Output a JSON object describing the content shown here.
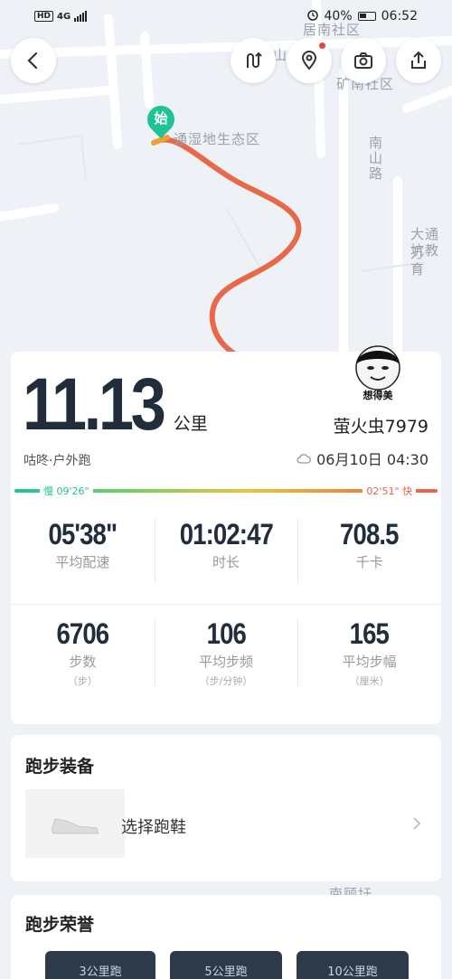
{
  "status_bar": {
    "network": "HD",
    "signal_gen": "4G",
    "battery": "40%",
    "time": "06:52"
  },
  "map_labels": {
    "l1": "居南社区",
    "l2": "矿南社区",
    "l3": "通湿地生态区",
    "l4": "南山路",
    "l5": "大通万",
    "l6": "坑教育",
    "l7": "山",
    "l8": "南顾圩"
  },
  "start_marker": "始",
  "summary": {
    "distance": "11.13",
    "distance_unit": "公里",
    "username": "萤火虫7979",
    "avatar_caption": "想得美",
    "subtitle": "咕咚·户外跑",
    "datetime": "06月10日 04:30",
    "pace_slow": "慢 09'26\"",
    "pace_fast": "02'51\" 快"
  },
  "stats_row1": [
    {
      "value": "05'38\"",
      "label": "平均配速"
    },
    {
      "value": "01:02:47",
      "label": "时长"
    },
    {
      "value": "708.5",
      "label": "千卡"
    }
  ],
  "stats_row2": [
    {
      "value": "6706",
      "label": "步数",
      "unit": "（步）"
    },
    {
      "value": "106",
      "label": "平均步频",
      "unit": "（步/分钟）"
    },
    {
      "value": "165",
      "label": "平均步幅",
      "unit": "（厘米）"
    }
  ],
  "gear": {
    "title": "跑步装备",
    "shoe_label": "选择跑鞋"
  },
  "honor": {
    "title": "跑步荣誉",
    "badges": [
      "3公里跑",
      "5公里跑",
      "10公里跑"
    ]
  },
  "colors": {
    "accent_green": "#1ec493",
    "route": "#e8684a",
    "dark_text": "#222d3b"
  }
}
